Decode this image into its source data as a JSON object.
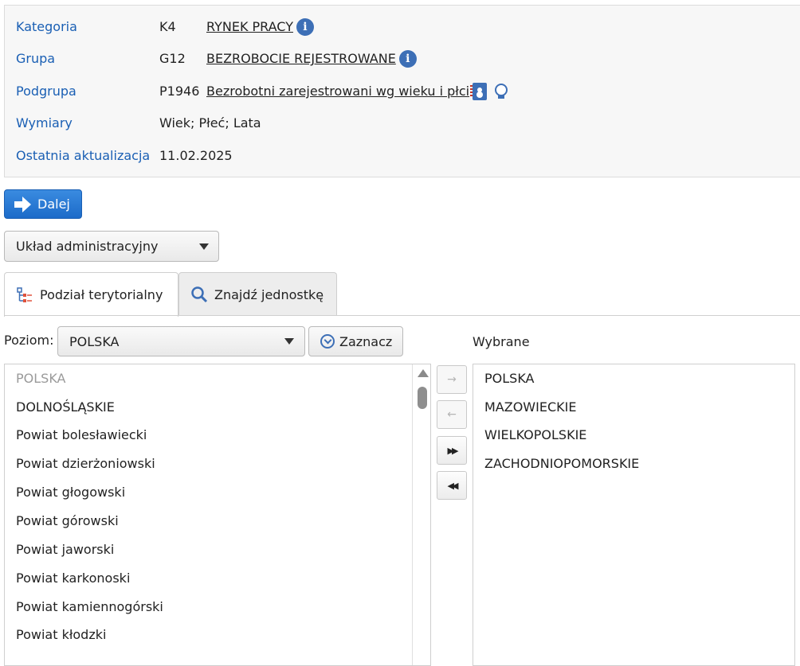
{
  "info": {
    "category_label": "Kategoria",
    "category_code": "K4",
    "category_value": "RYNEK PRACY",
    "group_label": "Grupa",
    "group_code": "G12",
    "group_value": "BEZROBOCIE REJESTROWANE",
    "subgroup_label": "Podgrupa",
    "subgroup_code": "P1946",
    "subgroup_value": "Bezrobotni zarejestrowani wg wieku i płci",
    "dimensions_label": "Wymiary",
    "dimensions_value": "Wiek; Płeć; Lata",
    "updated_label": "Ostatnia aktualizacja",
    "updated_value": "11.02.2025",
    "icons": [
      "info-icon",
      "info-icon",
      "metadata-book-icon",
      "lightbulb-icon"
    ]
  },
  "toolbar": {
    "next_label": "Dalej",
    "layout_select": "Układ administracyjny"
  },
  "tabs": [
    {
      "label": "Podział terytorialny",
      "icon": "tree-hierarchy-icon",
      "active": true
    },
    {
      "label": "Znajdź jednostkę",
      "icon": "search-icon",
      "active": false
    }
  ],
  "selector": {
    "level_label": "Poziom:",
    "level_value": "POLSKA",
    "mark_label": "Zaznacz",
    "selected_label": "Wybrane"
  },
  "available": [
    "POLSKA",
    "DOLNOŚLĄSKIE",
    "Powiat bolesławiecki",
    "Powiat dzierżoniowski",
    "Powiat głogowski",
    "Powiat górowski",
    "Powiat jaworski",
    "Powiat karkonoski",
    "Powiat kamiennogórski",
    "Powiat kłodzki"
  ],
  "selected": [
    "POLSKA",
    "MAZOWIECKIE",
    "WIELKOPOLSKIE",
    "ZACHODNIOPOMORSKIE"
  ],
  "move_buttons": [
    {
      "icon": "→",
      "name": "add-selected",
      "enabled": false
    },
    {
      "icon": "←",
      "name": "remove-selected",
      "enabled": false
    },
    {
      "icon": "▶▶",
      "name": "add-all",
      "enabled": true
    },
    {
      "icon": "◀◀",
      "name": "remove-all",
      "enabled": true
    }
  ],
  "colors": {
    "link_label": "#1a5fb4",
    "primary_button": "#1c6bc9",
    "icon_blue": "#3d6fb6"
  }
}
